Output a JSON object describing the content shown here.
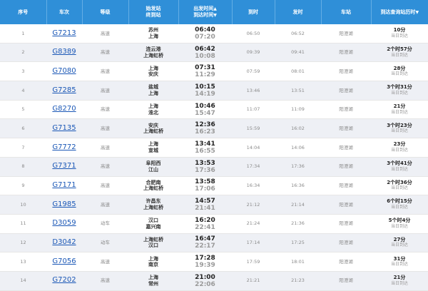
{
  "headers": {
    "seq": "序号",
    "train": "车次",
    "grade": "等级",
    "stations_line1": "始发站",
    "stations_line2": "终到站",
    "times_line1": "出发时间",
    "times_line2": "到达时间",
    "arrive": "到时",
    "depart": "发时",
    "station": "车站",
    "duration": "到达查询站历时"
  },
  "rows": [
    {
      "seq": "1",
      "train": "G7213",
      "grade": "高速",
      "from": "苏州",
      "to": "上海",
      "dep": "06:40",
      "arr": "07:20",
      "at": "06:50",
      "dt": "06:52",
      "station": "阳澄湖",
      "dur": "10分",
      "day": "当日到达"
    },
    {
      "seq": "2",
      "train": "G8389",
      "grade": "高速",
      "from": "连云港",
      "to": "上海虹桥",
      "dep": "06:42",
      "arr": "10:08",
      "at": "09:39",
      "dt": "09:41",
      "station": "阳澄湖",
      "dur": "2个时57分",
      "day": "当日到达"
    },
    {
      "seq": "3",
      "train": "G7080",
      "grade": "高速",
      "from": "上海",
      "to": "安庆",
      "dep": "07:31",
      "arr": "11:29",
      "at": "07:59",
      "dt": "08:01",
      "station": "阳澄湖",
      "dur": "28分",
      "day": "当日到达"
    },
    {
      "seq": "4",
      "train": "G7285",
      "grade": "高速",
      "from": "盐城",
      "to": "上海",
      "dep": "10:15",
      "arr": "14:19",
      "at": "13:46",
      "dt": "13:51",
      "station": "阳澄湖",
      "dur": "3个时31分",
      "day": "当日到达"
    },
    {
      "seq": "5",
      "train": "G8270",
      "grade": "高速",
      "from": "上海",
      "to": "淮北",
      "dep": "10:46",
      "arr": "15:47",
      "at": "11:07",
      "dt": "11:09",
      "station": "阳澄湖",
      "dur": "21分",
      "day": "当日到达"
    },
    {
      "seq": "6",
      "train": "G7135",
      "grade": "高速",
      "from": "安庆",
      "to": "上海虹桥",
      "dep": "12:36",
      "arr": "16:23",
      "at": "15:59",
      "dt": "16:02",
      "station": "阳澄湖",
      "dur": "3个时23分",
      "day": "当日到达"
    },
    {
      "seq": "7",
      "train": "G7772",
      "grade": "高速",
      "from": "上海",
      "to": "宣城",
      "dep": "13:41",
      "arr": "16:55",
      "at": "14:04",
      "dt": "14:06",
      "station": "阳澄湖",
      "dur": "23分",
      "day": "当日到达"
    },
    {
      "seq": "8",
      "train": "G7371",
      "grade": "高速",
      "from": "阜阳西",
      "to": "江山",
      "dep": "13:53",
      "arr": "17:36",
      "at": "17:34",
      "dt": "17:36",
      "station": "阳澄湖",
      "dur": "3个时41分",
      "day": "当日到达"
    },
    {
      "seq": "9",
      "train": "G7171",
      "grade": "高速",
      "from": "合肥南",
      "to": "上海虹桥",
      "dep": "13:58",
      "arr": "17:06",
      "at": "16:34",
      "dt": "16:36",
      "station": "阳澄湖",
      "dur": "2个时36分",
      "day": "当日到达"
    },
    {
      "seq": "10",
      "train": "G1985",
      "grade": "高速",
      "from": "许昌东",
      "to": "上海虹桥",
      "dep": "14:57",
      "arr": "21:41",
      "at": "21:12",
      "dt": "21:14",
      "station": "阳澄湖",
      "dur": "6个时15分",
      "day": "当日到达"
    },
    {
      "seq": "11",
      "train": "D3059",
      "grade": "动车",
      "from": "汉口",
      "to": "嘉兴南",
      "dep": "16:20",
      "arr": "22:41",
      "at": "21:24",
      "dt": "21:36",
      "station": "阳澄湖",
      "dur": "5个时4分",
      "day": "当日到达"
    },
    {
      "seq": "12",
      "train": "D3042",
      "grade": "动车",
      "from": "上海虹桥",
      "to": "汉口",
      "dep": "16:47",
      "arr": "22:17",
      "at": "17:14",
      "dt": "17:25",
      "station": "阳澄湖",
      "dur": "27分",
      "day": "当日到达"
    },
    {
      "seq": "13",
      "train": "G7056",
      "grade": "高速",
      "from": "上海",
      "to": "南京",
      "dep": "17:28",
      "arr": "19:39",
      "at": "17:59",
      "dt": "18:01",
      "station": "阳澄湖",
      "dur": "31分",
      "day": "当日到达"
    },
    {
      "seq": "14",
      "train": "G7202",
      "grade": "高速",
      "from": "上海",
      "to": "常州",
      "dep": "21:00",
      "arr": "22:06",
      "at": "21:21",
      "dt": "21:23",
      "station": "阳澄湖",
      "dur": "21分",
      "day": "当日到达"
    }
  ]
}
